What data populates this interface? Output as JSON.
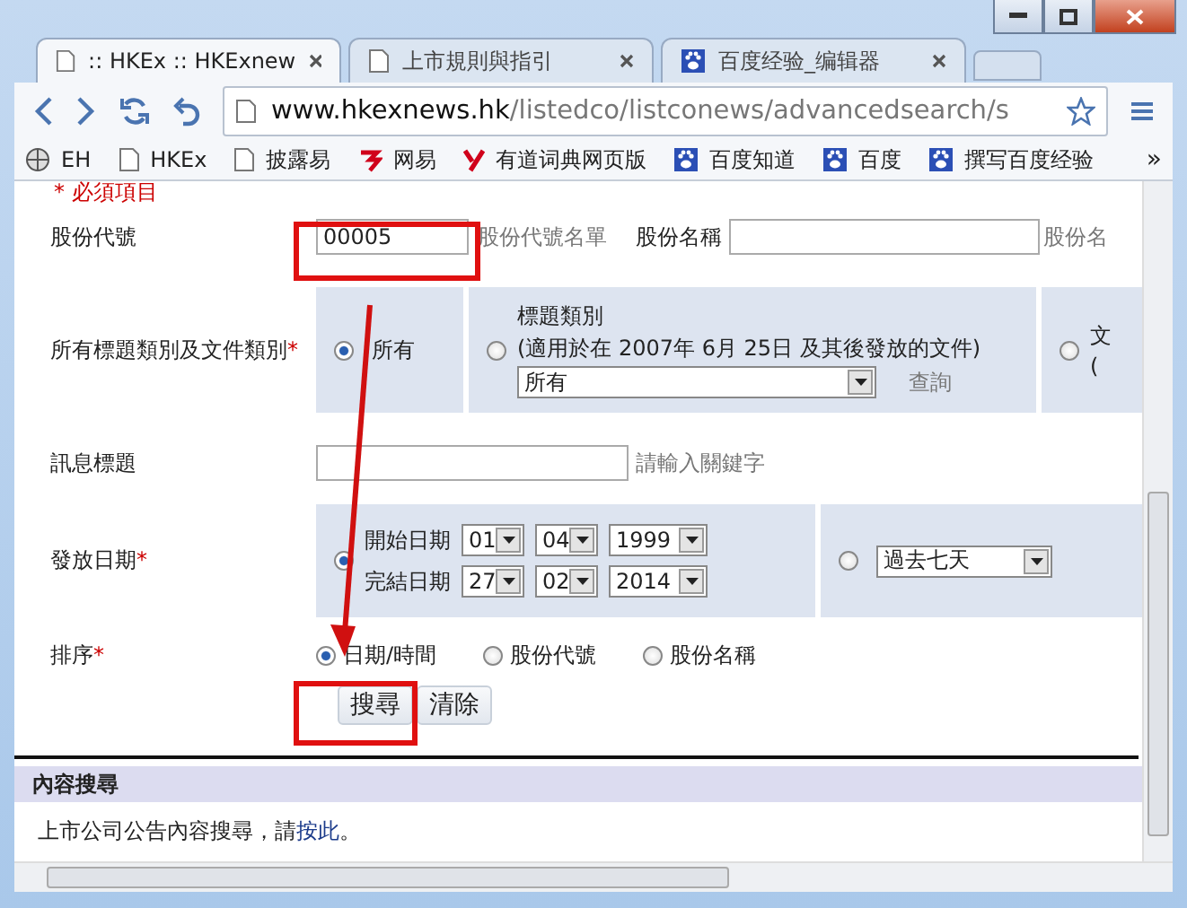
{
  "tabs": [
    {
      "title": ":: HKEx :: HKExnew",
      "kind": "page",
      "selected": true
    },
    {
      "title": "上市規則與指引",
      "kind": "page",
      "selected": false
    },
    {
      "title": "百度经验_编辑器",
      "kind": "paw",
      "selected": false
    }
  ],
  "address": {
    "host": "www.hkexnews.hk",
    "path": "/listedco/listconews/advancedsearch/s"
  },
  "bookmarks": [
    {
      "label": "EH",
      "kind": "globe"
    },
    {
      "label": "HKEx",
      "kind": "page"
    },
    {
      "label": "披露易",
      "kind": "page"
    },
    {
      "label": "网易",
      "kind": "netease"
    },
    {
      "label": "有道词典网页版",
      "kind": "youdao"
    },
    {
      "label": "百度知道",
      "kind": "paw"
    },
    {
      "label": "百度",
      "kind": "paw"
    },
    {
      "label": "撰写百度经验",
      "kind": "paw"
    }
  ],
  "bookmarks_more": "»",
  "form": {
    "required_note": "* 必須項目",
    "stock_code": {
      "label": "股份代號",
      "value": "00005",
      "link": "股份代號名單"
    },
    "stock_name": {
      "label": "股份名稱",
      "link": "股份名"
    },
    "category": {
      "label": "所有標題類別及文件類別",
      "required_mark": "*",
      "options": [
        {
          "kind": "plain",
          "label": "所有",
          "selected": true
        },
        {
          "kind": "select",
          "title": "標題類別",
          "note": "(適用於在 2007年 6月 25日 及其後發放的文件)",
          "value": "所有",
          "link": "查詢",
          "selected": false
        },
        {
          "kind": "cut",
          "title": "文",
          "note": "(",
          "selected": false
        }
      ]
    },
    "headline": {
      "label": "訊息標題",
      "hint": "請輸入關鍵字"
    },
    "date": {
      "label": "發放日期",
      "required_mark": "*",
      "options": [
        {
          "kind": "range",
          "selected": true,
          "from_label": "開始日期",
          "from": [
            "01",
            "04",
            "1999"
          ],
          "to_label": "完結日期",
          "to": [
            "27",
            "02",
            "2014"
          ]
        },
        {
          "kind": "preset",
          "selected": false,
          "value": "過去七天"
        }
      ]
    },
    "sort": {
      "label": "排序",
      "required_mark": "*",
      "options": [
        {
          "label": "日期/時間",
          "selected": true
        },
        {
          "label": "股份代號",
          "selected": false
        },
        {
          "label": "股份名稱",
          "selected": false
        }
      ]
    },
    "buttons": [
      "搜尋",
      "清除"
    ]
  },
  "content_search": {
    "title": "內容搜尋",
    "text": "上市公司公告內容搜尋，請",
    "link": "按此",
    "after": "。"
  }
}
